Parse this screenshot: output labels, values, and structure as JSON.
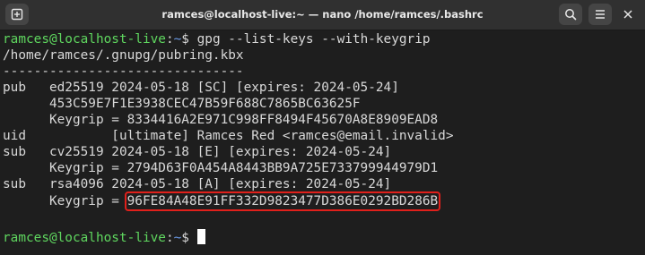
{
  "window": {
    "title": "ramces@localhost-live:~ — nano /home/ramces/.bashrc"
  },
  "icons": {
    "new_tab": "new-tab-icon",
    "search": "search-icon",
    "menu": "hamburger-menu-icon",
    "close": "close-icon"
  },
  "colors": {
    "prompt_user": "#5fd75f",
    "prompt_path": "#6b9be8",
    "highlight_box": "#e0201b"
  },
  "terminal": {
    "prompt1": {
      "user": "ramces@localhost-live",
      "sep": ":",
      "path": "~",
      "sym": "$ ",
      "command": "gpg --list-keys --with-keygrip"
    },
    "lines": [
      "/home/ramces/.gnupg/pubring.kbx",
      "-------------------------------",
      "pub   ed25519 2024-05-18 [SC] [expires: 2024-05-24]",
      "      453C59E7F1E3938CEC47B59F688C7865BC63625F",
      "      Keygrip = 8334416A2E971C998FF8494F45670A8E8909EAD8",
      "uid           [ultimate] Ramces Red <ramces@email.invalid>",
      "sub   cv25519 2024-05-18 [E] [expires: 2024-05-24]",
      "      Keygrip = 2794D63F0A454A8443BB9A725E733799944979D1",
      "sub   rsa4096 2024-05-18 [A] [expires: 2024-05-24]"
    ],
    "last_keygrip_label": "      Keygrip = ",
    "last_keygrip_value": "96FE84A48E91FF332D9823477D386E0292BD286B",
    "prompt2": {
      "user": "ramces@localhost-live",
      "sep": ":",
      "path": "~",
      "sym": "$ "
    }
  }
}
